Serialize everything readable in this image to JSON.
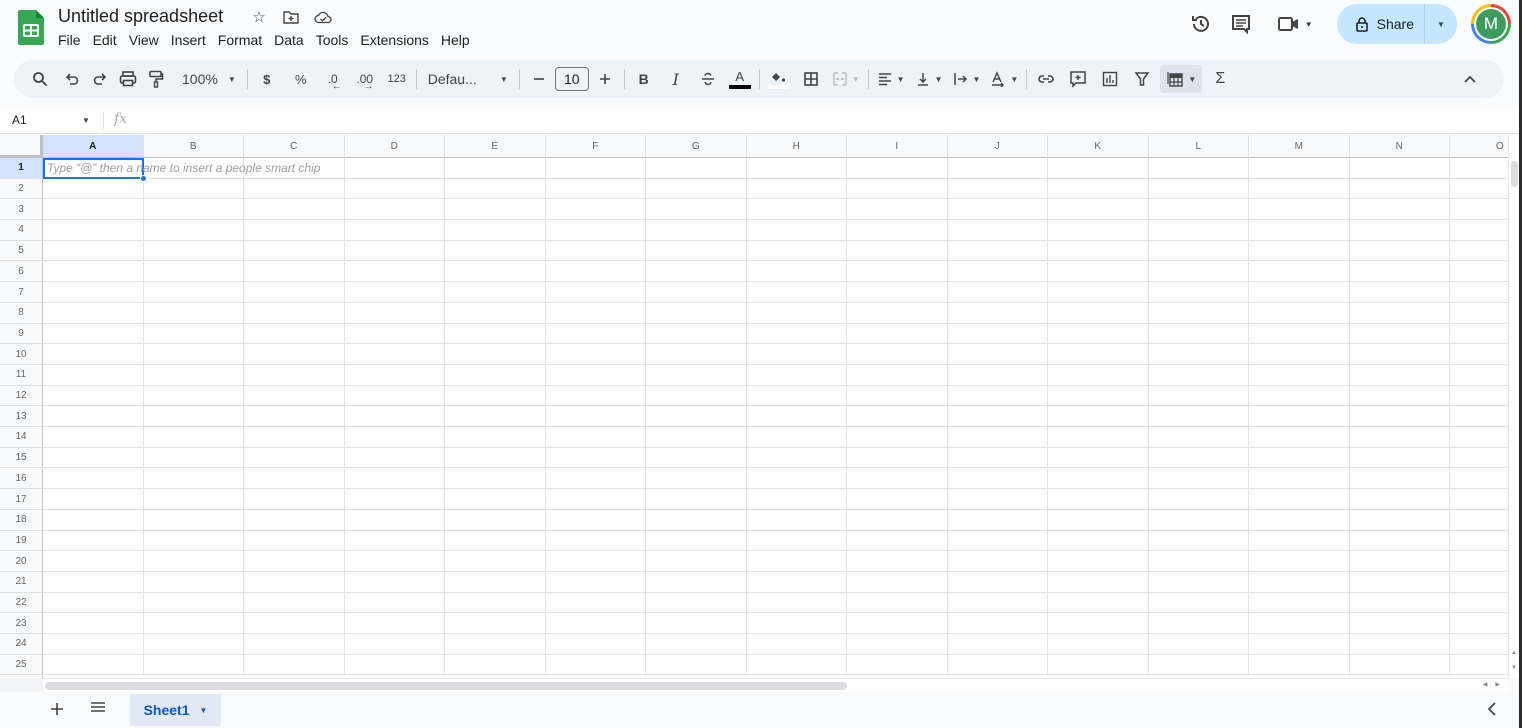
{
  "app": {
    "title": "Untitled spreadsheet",
    "menu": [
      "File",
      "Edit",
      "View",
      "Insert",
      "Format",
      "Data",
      "Tools",
      "Extensions",
      "Help"
    ],
    "share_label": "Share",
    "avatar_initial": "M",
    "colors": {
      "brand_green": "#0f9d58",
      "accent_blue": "#1a73e8",
      "share_bg": "#c2e7ff",
      "selected_header": "#d3e3fd",
      "avatar_bg": "#3f9a5e"
    }
  },
  "toolbar": {
    "zoom": "100%",
    "currency": "$",
    "percent": "%",
    "decrease_decimal": ".0",
    "increase_decimal": ".00",
    "more_formats": "123",
    "font": "Defau...",
    "font_size": "10",
    "bold": "B",
    "italic": "I",
    "text_color": "A",
    "functions": "Σ"
  },
  "formula_bar": {
    "name_box": "A1",
    "fx_label": "fx",
    "value": ""
  },
  "grid": {
    "columns": [
      "A",
      "B",
      "C",
      "D",
      "E",
      "F",
      "G",
      "H",
      "I",
      "J",
      "K",
      "L",
      "M",
      "N",
      "O"
    ],
    "rows": [
      "1",
      "2",
      "3",
      "4",
      "5",
      "6",
      "7",
      "8",
      "9",
      "10",
      "11",
      "12",
      "13",
      "14",
      "15",
      "16",
      "17",
      "18",
      "19",
      "20",
      "21",
      "22",
      "23",
      "24",
      "25"
    ],
    "selected_cell": "A1",
    "cell_hint": "Type “@” then a name to insert a people smart chip"
  },
  "sheets": {
    "tabs": [
      {
        "label": "Sheet1",
        "active": true
      }
    ]
  }
}
